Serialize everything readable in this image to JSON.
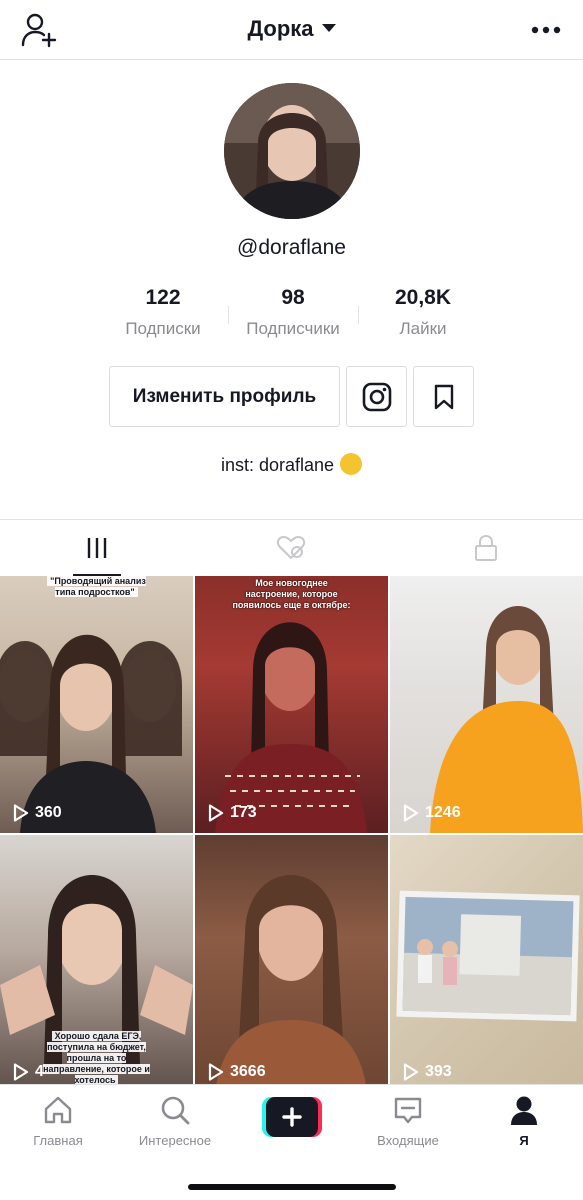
{
  "header": {
    "title": "Дорка"
  },
  "profile": {
    "username": "@doraflane",
    "stats": [
      {
        "value": "122",
        "label": "Подписки"
      },
      {
        "value": "98",
        "label": "Подписчики"
      },
      {
        "value": "20,8K",
        "label": "Лайки"
      }
    ],
    "edit_button": "Изменить профиль",
    "bio": "inst: doraflane"
  },
  "videos": [
    {
      "views": "360",
      "caption": "\"Проводящий анализ типа подростков\""
    },
    {
      "views": "173",
      "caption": "Мое новогоднее настроение, которое появилось еще в октябре:"
    },
    {
      "views": "1246",
      "caption": ""
    },
    {
      "views": "4",
      "caption": "Хорошо сдала ЕГЭ, поступила на бюджет, прошла на то направление, которое и хотелось"
    },
    {
      "views": "3666",
      "caption": ""
    },
    {
      "views": "393",
      "caption": ""
    }
  ],
  "bottom_nav": [
    {
      "label": "Главная",
      "icon": "home-icon"
    },
    {
      "label": "Интересное",
      "icon": "search-icon"
    },
    {
      "label": "",
      "icon": "create-icon"
    },
    {
      "label": "Входящие",
      "icon": "inbox-icon"
    },
    {
      "label": "Я",
      "icon": "profile-icon"
    }
  ],
  "colors": {
    "accent_pink": "#fe2c55",
    "accent_cyan": "#25f4ee",
    "text": "#161823",
    "muted": "#8a8b91"
  }
}
